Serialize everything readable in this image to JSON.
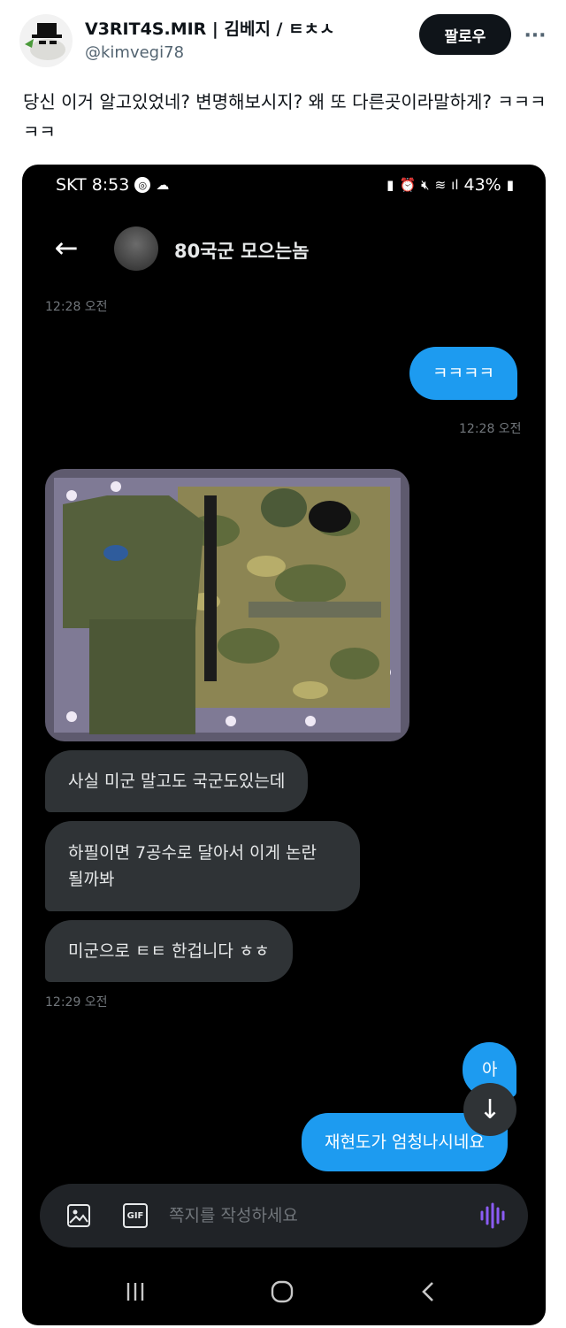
{
  "tweet": {
    "display_name": "V3RIT4S.MIR | 김베지 / ㅌㅊㅅ",
    "handle": "@kimvegi78",
    "follow_label": "팔로우",
    "more_label": "···",
    "text": "당신 이거 알고있었네? 변명해보시지? 왜 또 다른곳이라말하게? ㅋㅋㅋㅋㅋ"
  },
  "status_bar": {
    "carrier_time": "SKT 8:53",
    "battery": "43%"
  },
  "dm": {
    "back_icon": "arrow-left-icon",
    "contact_name": "80국군 모으는놈",
    "messages": [
      {
        "type": "timestamp",
        "text": "12:28 오전"
      },
      {
        "type": "outgoing",
        "text": "ㅋㅋㅋㅋ"
      },
      {
        "type": "timestamp",
        "text": "12:28 오전"
      },
      {
        "type": "incoming",
        "text": "사실 미군 말고도 국군도있는데"
      },
      {
        "type": "incoming",
        "text": "하필이면 7공수로 달아서 이게 논란 될까봐"
      },
      {
        "type": "incoming",
        "text": "미군으로 ㅌㅌ 한겁니다 ㅎㅎ"
      },
      {
        "type": "timestamp",
        "text": "12:29 오전"
      },
      {
        "type": "outgoing",
        "text": "아"
      },
      {
        "type": "outgoing",
        "text": "재현도가 엄청나시네요"
      }
    ]
  },
  "composer": {
    "placeholder": "쪽지를 작성하세요",
    "image_icon": "image-icon",
    "gif_label": "GIF",
    "voice_icon": "voice-wave-icon"
  },
  "colors": {
    "bubble_out": "#1d9bf0",
    "bubble_in": "#2f3336",
    "voice_accent": "#8b5cf6"
  }
}
